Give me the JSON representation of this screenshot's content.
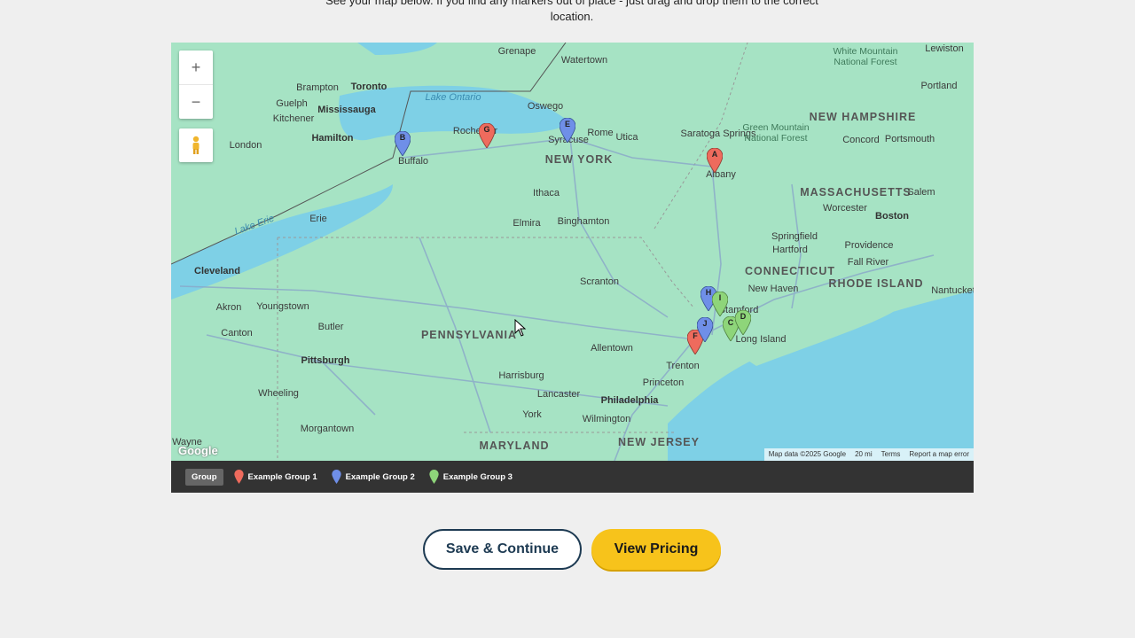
{
  "intro": {
    "line1": "See your map below. If you find any markers out of place - just drag and drop them to the correct",
    "line2": "location."
  },
  "map": {
    "zoom_in": "+",
    "zoom_out": "−",
    "google_logo": "Google",
    "attribution": {
      "map_data": "Map data ©2025 Google",
      "scale": "20 mi",
      "terms": "Terms",
      "report": "Report a map error"
    },
    "states": [
      "NEW YORK",
      "PENNSYLVANIA",
      "NEW JERSEY",
      "MARYLAND",
      "CONNECTICUT",
      "MASSACHUSETTS",
      "NEW HAMPSHIRE",
      "RHODE ISLAND"
    ],
    "cities": [
      "Toronto",
      "Mississauga",
      "Hamilton",
      "Buffalo",
      "Rochester",
      "Syracuse",
      "Albany",
      "Boston",
      "Cleveland",
      "Pittsburgh",
      "Philadelphia",
      "Hartford",
      "Providence",
      "New Haven",
      "Springfield",
      "Worcester",
      "Scranton",
      "Allentown",
      "Harrisburg",
      "Binghamton",
      "Utica",
      "Rome",
      "Oswego",
      "Ithaca",
      "Elmira",
      "Erie",
      "Akron",
      "Youngstown",
      "Canton",
      "Butler",
      "Wheeling",
      "Morgantown",
      "Lancaster",
      "York",
      "Wilmington",
      "Princeton",
      "Trenton",
      "Kitchener",
      "Guelph",
      "Brampton",
      "London",
      "Watertown",
      "Lewiston",
      "Portland",
      "Concord",
      "Portsmouth",
      "Salem",
      "Saratoga Springs",
      "Fall River",
      "Nantucket",
      "Stamford",
      "Long Island",
      "Wayne",
      "Grenape"
    ],
    "water": [
      "Lake Ontario",
      "Lake Erie"
    ],
    "forests": [
      "Green Mountain National Forest",
      "White Mountain National Forest"
    ],
    "markers": [
      {
        "letter": "A",
        "group": 1
      },
      {
        "letter": "B",
        "group": 2
      },
      {
        "letter": "C",
        "group": 3
      },
      {
        "letter": "D",
        "group": 3
      },
      {
        "letter": "E",
        "group": 2
      },
      {
        "letter": "F",
        "group": 1
      },
      {
        "letter": "G",
        "group": 1
      },
      {
        "letter": "H",
        "group": 2
      },
      {
        "letter": "I",
        "group": 3
      },
      {
        "letter": "J",
        "group": 2
      }
    ],
    "group_colors": {
      "1": "#ee6b5d",
      "2": "#6f8fe8",
      "3": "#8ed57a"
    }
  },
  "legend": {
    "group_button": "Group",
    "items": [
      {
        "label": "Example Group 1",
        "color": "#ee6b5d"
      },
      {
        "label": "Example Group 2",
        "color": "#6f8fe8"
      },
      {
        "label": "Example Group 3",
        "color": "#8ed57a"
      }
    ]
  },
  "actions": {
    "save_label": "Save & Continue",
    "pricing_label": "View Pricing"
  }
}
